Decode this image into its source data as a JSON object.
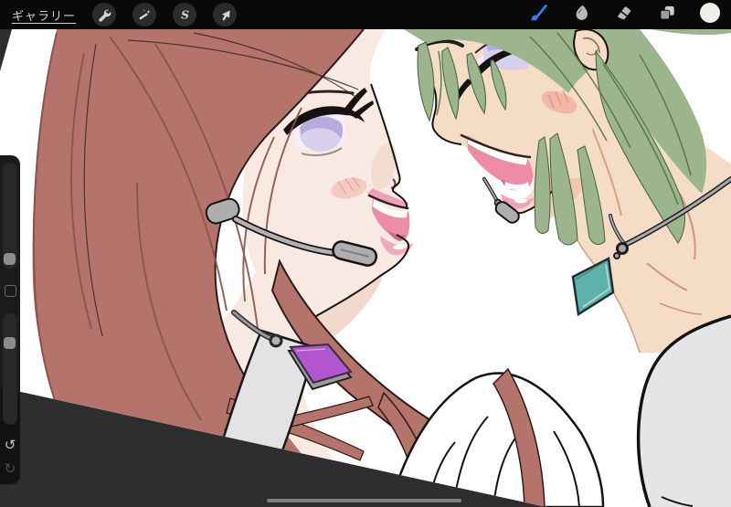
{
  "topbar": {
    "gallery_label": "ギャラリー",
    "left_tools": [
      {
        "id": "actions",
        "label": "Actions",
        "icon": "wrench-icon"
      },
      {
        "id": "adjustments",
        "label": "Adjustments",
        "icon": "magic-wand-icon"
      },
      {
        "id": "selection",
        "label": "Selection",
        "icon": "s-curve-icon",
        "glyph": "S"
      },
      {
        "id": "transform",
        "label": "Transform",
        "icon": "arrow-cursor-icon"
      }
    ],
    "right_tools": [
      {
        "id": "paint",
        "label": "Paint",
        "icon": "brush-icon",
        "selected": true
      },
      {
        "id": "smudge",
        "label": "Smudge",
        "icon": "smudge-finger-icon",
        "selected": false
      },
      {
        "id": "erase",
        "label": "Erase",
        "icon": "eraser-icon",
        "selected": false
      },
      {
        "id": "layers",
        "label": "Layers",
        "icon": "layers-icon",
        "selected": false
      },
      {
        "id": "color",
        "label": "Color",
        "icon": "color-swatch-circle",
        "selected": false
      }
    ]
  },
  "sidebar": {
    "sliders": [
      {
        "id": "brush-size",
        "value_pct": 91
      },
      {
        "id": "brush-opacity",
        "value_pct": 27
      }
    ],
    "modify_button": "modify",
    "undo_label": "↺",
    "redo_label": "↻"
  },
  "canvas": {
    "rotation_deg": 13,
    "scrollbar_visible": true,
    "artwork_description": "Anime-style illustration of two characters face to face: left character with long dusty-red hair, lavender eye, pink open-mouth smile, gray headset microphone, white strap top and purple diamond pendant; right character with sage-green hair, lavender eye, open laughing smile, small chin microphone, teal diamond pendant and light gray sleeve."
  },
  "colors": {
    "accent-blue": "#3878f0",
    "topbar-bg": "#09090a",
    "icon-gray": "#c9c9cb",
    "workspace-bg": "#2d2d2f",
    "grid-line": "#38383b",
    "canvas-white": "#ffffff",
    "hair-red": "#b4746c",
    "hair-red-line": "#8a534d",
    "hair-green": "#9db58e",
    "hair-green-line": "#54713f",
    "skin-left": "#f8eae2",
    "skin-right": "#f4dcc7",
    "pendant-purple": "#b156cc",
    "pendant-teal": "#5fb2aa",
    "mouth-pink": "#ee8ba7",
    "iris-lavender": "#d9d0f0",
    "hardware-gray": "#aeaeb0",
    "scrollbar-gray": "#7e7e80"
  }
}
